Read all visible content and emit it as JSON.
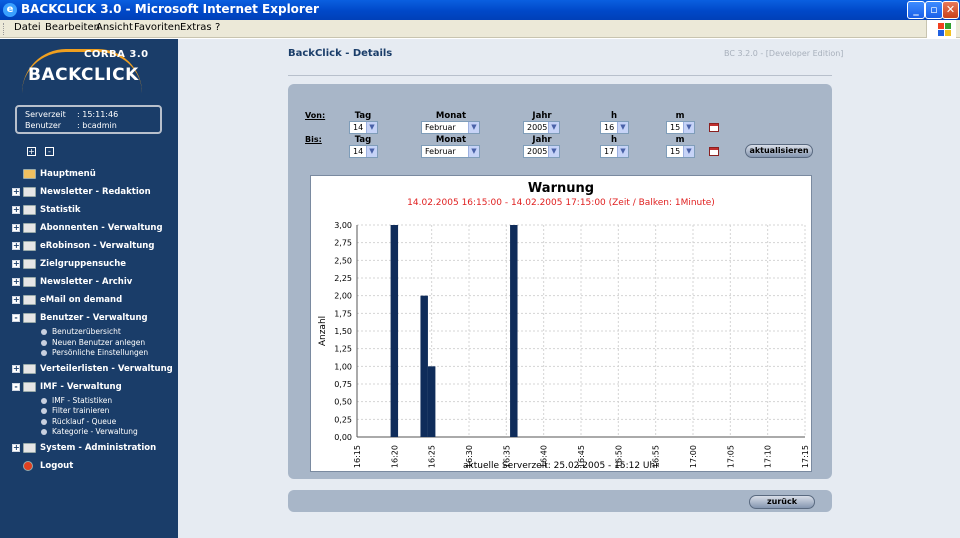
{
  "window": {
    "title": "BACKCLICK 3.0 - Microsoft Internet Explorer"
  },
  "menubar": {
    "items": [
      "Datei",
      "Bearbeiten",
      "Ansicht",
      "Favoriten",
      "Extras",
      "?"
    ]
  },
  "sidebar": {
    "logo_top": "CORBA 3.0",
    "logo_brand": "BACKCLICK",
    "info": {
      "server_label": "Serverzeit",
      "server_value": ": 15:11:46",
      "user_label": "Benutzer",
      "user_value": ": bcadmin"
    },
    "nav": [
      {
        "label": "Hauptmenü",
        "type": "home"
      },
      {
        "label": "Newsletter - Redaktion",
        "type": "folder",
        "expanded": false
      },
      {
        "label": "Statistik",
        "type": "folder",
        "expanded": false
      },
      {
        "label": "Abonnenten - Verwaltung",
        "type": "folder",
        "expanded": false
      },
      {
        "label": "eRobinson - Verwaltung",
        "type": "folder",
        "expanded": false
      },
      {
        "label": "Zielgruppensuche",
        "type": "folder",
        "expanded": false
      },
      {
        "label": "Newsletter - Archiv",
        "type": "folder",
        "expanded": false
      },
      {
        "label": "eMail on demand",
        "type": "folder",
        "expanded": false
      },
      {
        "label": "Benutzer - Verwaltung",
        "type": "users",
        "expanded": true,
        "children": [
          "Benutzerübersicht",
          "Neuen Benutzer anlegen",
          "Persönliche Einstellungen"
        ]
      },
      {
        "label": "Verteilerlisten - Verwaltung",
        "type": "folder",
        "expanded": false
      },
      {
        "label": "IMF - Verwaltung",
        "type": "users",
        "expanded": true,
        "children": [
          "IMF - Statistiken",
          "Filter trainieren",
          "Rücklauf - Queue",
          "Kategorie - Verwaltung"
        ]
      },
      {
        "label": "System - Administration",
        "type": "folder",
        "expanded": false
      },
      {
        "label": "Logout",
        "type": "logout"
      }
    ]
  },
  "main": {
    "title": "BackClick - Details",
    "edition": "BC 3.2.0 - [Developer Edition]",
    "form": {
      "von_label": "Von:",
      "bis_label": "Bis:",
      "headers": [
        "Tag",
        "Monat",
        "Jahr",
        "h",
        "m"
      ],
      "von": {
        "tag": "14",
        "monat": "Februar",
        "jahr": "2005",
        "h": "16",
        "m": "15"
      },
      "bis": {
        "tag": "14",
        "monat": "Februar",
        "jahr": "2005",
        "h": "17",
        "m": "15"
      },
      "refresh_label": "aktualisieren"
    },
    "back_label": "zurück"
  },
  "chart_data": {
    "type": "bar",
    "title": "Warnung",
    "subtitle": "14.02.2005 16:15:00 - 14.02.2005 17:15:00  (Zeit / Balken: 1Minute)",
    "ylabel": "Anzahl",
    "xlabel": "",
    "footer": "aktuelle Serverzeit: 25.02.2005 - 15:12 Uhr",
    "ylim": [
      0,
      3
    ],
    "yticks": [
      "0,00",
      "0,25",
      "0,50",
      "0,75",
      "1,00",
      "1,25",
      "1,50",
      "1,75",
      "2,00",
      "2,25",
      "2,50",
      "2,75",
      "3,00"
    ],
    "xlim_minutes": [
      15,
      75
    ],
    "xticks": [
      "16:15",
      "16:20",
      "16:25",
      "16:30",
      "16:35",
      "16:40",
      "16:45",
      "16:50",
      "16:55",
      "17:00",
      "17:05",
      "17:10",
      "17:15"
    ],
    "bars": [
      {
        "minute": 20,
        "value": 3
      },
      {
        "minute": 24,
        "value": 2
      },
      {
        "minute": 25,
        "value": 1
      },
      {
        "minute": 36,
        "value": 3
      }
    ],
    "bar_color": "#0f2c5a",
    "grid": true
  }
}
